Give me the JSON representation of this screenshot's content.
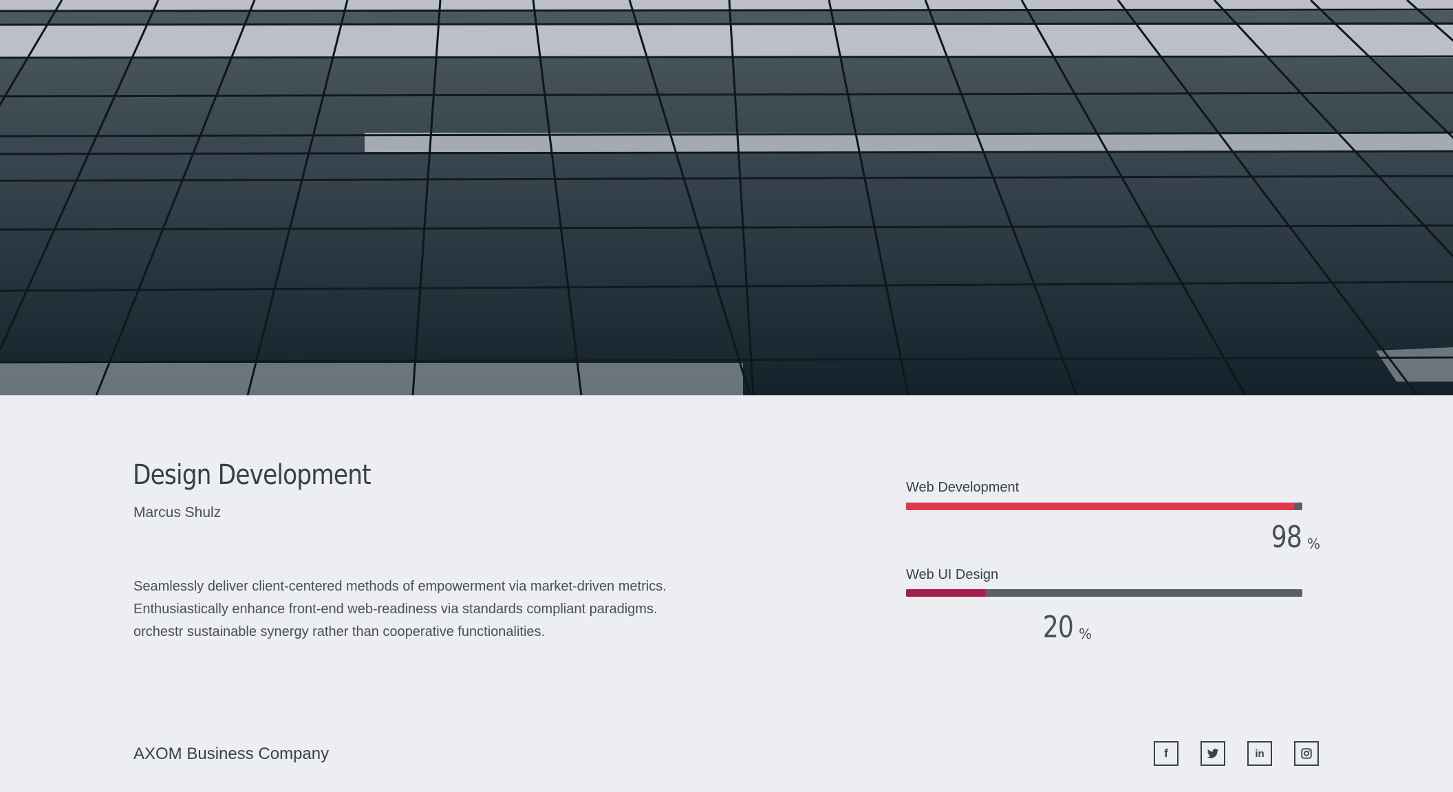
{
  "hero": {
    "image": "building-facade-photo"
  },
  "content": {
    "title": "Design Development",
    "author": "Marcus Shulz",
    "description": "Seamlessly deliver client-centered methods of empowerment via market-driven metrics. Enthusiastically enhance front-end web-readiness via standards compliant paradigms. orchestr sustainable synergy rather than cooperative functionalities."
  },
  "skills": [
    {
      "label": "Web Development",
      "value": 98,
      "unit": "%",
      "color": "#e0384f",
      "track_color": "#5b5e66"
    },
    {
      "label": "Web UI Design",
      "value": 20,
      "unit": "%",
      "color": "#a31e48",
      "track_color": "#5b5e66"
    }
  ],
  "footer": {
    "company": "AXOM Business Company",
    "social": [
      {
        "icon": "facebook-icon",
        "glyph": "f"
      },
      {
        "icon": "twitter-icon",
        "glyph": ""
      },
      {
        "icon": "linkedin-icon",
        "glyph": "in"
      },
      {
        "icon": "instagram-icon",
        "glyph": ""
      }
    ]
  }
}
